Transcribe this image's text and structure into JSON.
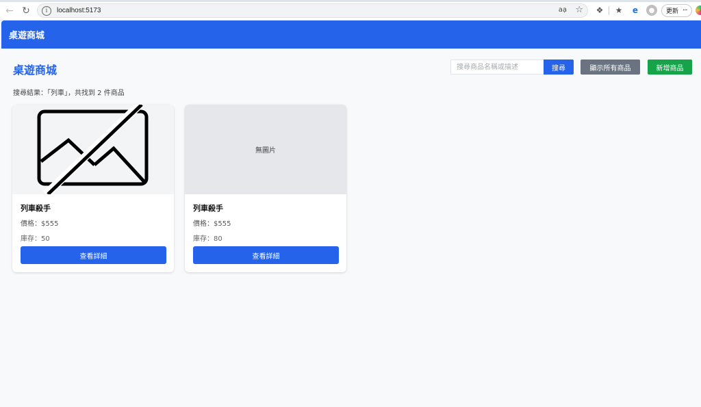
{
  "browser": {
    "url": "localhost:5173",
    "update_label": "更新",
    "more_label": "···"
  },
  "header": {
    "brand": "桌遊商城"
  },
  "page": {
    "title": "桌遊商城",
    "search_placeholder": "搜尋商品名稱或描述",
    "search_label": "搜尋",
    "show_all_label": "顯示所有商品",
    "add_label": "新增商品",
    "result_text": "搜尋結果：「列車」，共找到 2 件商品"
  },
  "products": [
    {
      "name": "列車殺手",
      "price": "價格：$555",
      "stock": "庫存：50",
      "image": "broken-image-icon",
      "button": "查看詳細"
    },
    {
      "name": "列車殺手",
      "price": "價格：$555",
      "stock": "庫存：80",
      "image_text": "無圖片",
      "button": "查看詳細"
    }
  ],
  "colors": {
    "primary": "#2563eb",
    "secondary": "#6b7280",
    "success": "#16a34a"
  }
}
